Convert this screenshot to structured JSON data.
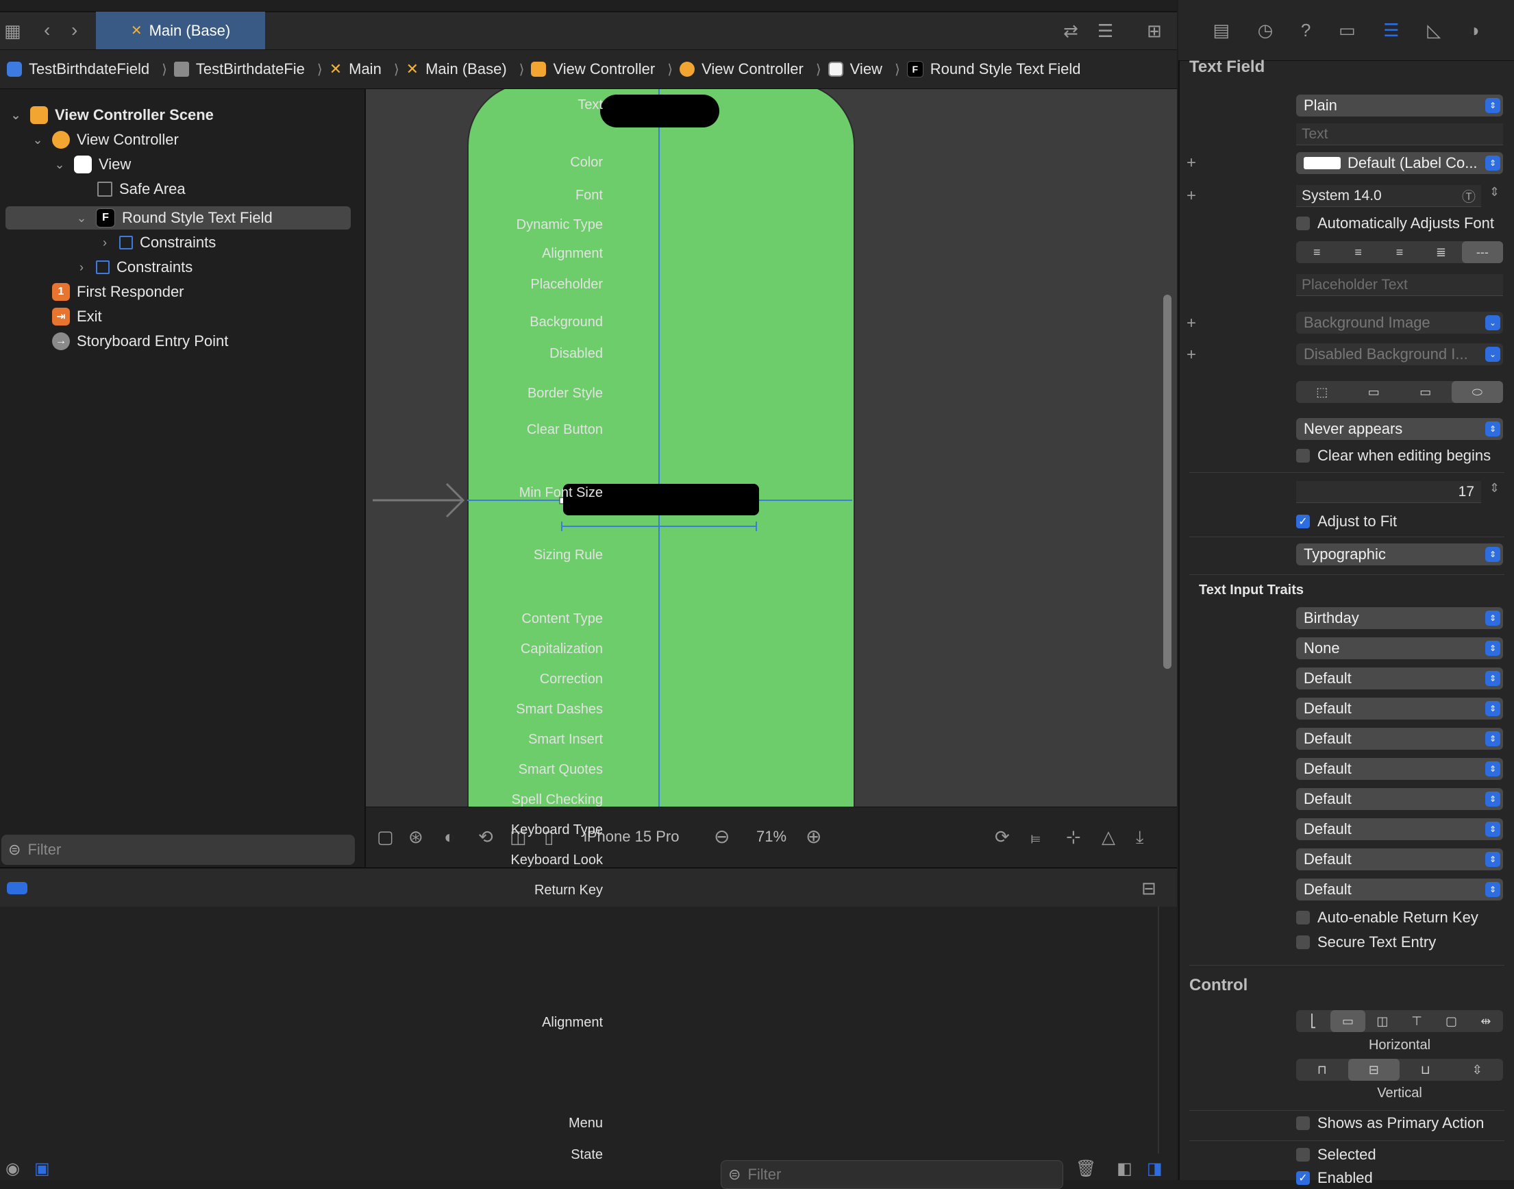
{
  "window": {
    "active_tab": "Main (Base)"
  },
  "breadcrumb": [
    {
      "label": "TestBirthdateField",
      "icon": "project-icon"
    },
    {
      "label": "TestBirthdateFie",
      "icon": "folder-icon"
    },
    {
      "label": "Main",
      "icon": "storyboard-icon"
    },
    {
      "label": "Main (Base)",
      "icon": "storyboard-icon"
    },
    {
      "label": "View Controller",
      "icon": "scene-icon"
    },
    {
      "label": "View Controller",
      "icon": "view-controller-icon"
    },
    {
      "label": "View",
      "icon": "view-icon"
    },
    {
      "label": "Round Style Text Field",
      "icon": "text-field-icon"
    }
  ],
  "navigator": {
    "items": [
      {
        "label": "View Controller Scene"
      },
      {
        "label": "View Controller"
      },
      {
        "label": "View"
      },
      {
        "label": "Safe Area"
      },
      {
        "label": "Round Style Text Field"
      },
      {
        "label": "Constraints"
      },
      {
        "label": "Constraints"
      },
      {
        "label": "First Responder"
      },
      {
        "label": "Exit"
      },
      {
        "label": "Storyboard Entry Point"
      }
    ],
    "filter_placeholder": "Filter",
    "first_responder_badge": "1",
    "text_field_badge": "F"
  },
  "canvas_toolbar": {
    "device": "iPhone 15 Pro",
    "zoom": "71%"
  },
  "console": {
    "filter_placeholder": "Filter"
  },
  "inspector": {
    "section_title": "Text Field",
    "text_label": "Text",
    "text_value": "Plain",
    "text_placeholder": "Text",
    "color_label": "Color",
    "color_value": "Default (Label Co...",
    "font_label": "Font",
    "font_value": "System 14.0",
    "dynamic_type_label": "Dynamic Type",
    "dynamic_type_check": "Automatically Adjusts Font",
    "alignment_label": "Alignment",
    "placeholder_label": "Placeholder",
    "placeholder_placeholder": "Placeholder Text",
    "background_label": "Background",
    "background_value": "Background Image",
    "disabled_label": "Disabled",
    "disabled_value": "Disabled Background I...",
    "border_style_label": "Border Style",
    "clear_button_label": "Clear Button",
    "clear_button_value": "Never appears",
    "clear_editing_check": "Clear when editing begins",
    "min_font_label": "Min Font Size",
    "min_font_value": "17",
    "adjust_fit_check": "Adjust to Fit",
    "sizing_rule_label": "Sizing Rule",
    "sizing_rule_value": "Typographic",
    "traits_title": "Text Input Traits",
    "traits": [
      {
        "label": "Content Type",
        "value": "Birthday"
      },
      {
        "label": "Capitalization",
        "value": "None"
      },
      {
        "label": "Correction",
        "value": "Default"
      },
      {
        "label": "Smart Dashes",
        "value": "Default"
      },
      {
        "label": "Smart Insert",
        "value": "Default"
      },
      {
        "label": "Smart Quotes",
        "value": "Default"
      },
      {
        "label": "Spell Checking",
        "value": "Default"
      },
      {
        "label": "Keyboard Type",
        "value": "Default"
      },
      {
        "label": "Keyboard Look",
        "value": "Default"
      },
      {
        "label": "Return Key",
        "value": "Default"
      }
    ],
    "auto_return_check": "Auto-enable Return Key",
    "secure_check": "Secure Text Entry",
    "control_title": "Control",
    "control_alignment_label": "Alignment",
    "horizontal_label": "Horizontal",
    "vertical_label": "Vertical",
    "menu_label": "Menu",
    "menu_check": "Shows as Primary Action",
    "state_label": "State",
    "selected_check": "Selected",
    "enabled_check": "Enabled"
  },
  "colors": {
    "canvas_view": "#6dcd6a",
    "accent": "#2d6de0"
  }
}
